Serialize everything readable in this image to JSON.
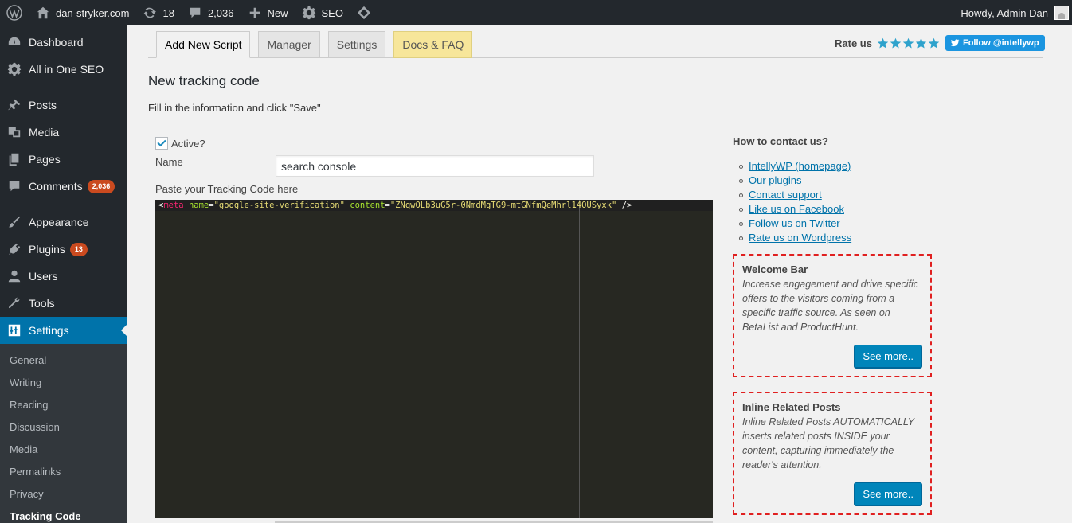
{
  "adminbar": {
    "site_name": "dan-stryker.com",
    "updates_count": "18",
    "comments_count": "2,036",
    "new_label": "New",
    "seo_label": "SEO",
    "howdy": "Howdy, Admin Dan"
  },
  "sidebar": {
    "items": [
      {
        "label": "Dashboard",
        "icon": "dashboard-icon"
      },
      {
        "label": "All in One SEO",
        "icon": "gear-icon"
      },
      {
        "label": "Posts",
        "icon": "pin-icon"
      },
      {
        "label": "Media",
        "icon": "media-icon"
      },
      {
        "label": "Pages",
        "icon": "pages-icon"
      },
      {
        "label": "Comments",
        "icon": "comment-icon",
        "badge": "2,036"
      },
      {
        "label": "Appearance",
        "icon": "brush-icon"
      },
      {
        "label": "Plugins",
        "icon": "plugin-icon",
        "badge": "13"
      },
      {
        "label": "Users",
        "icon": "user-icon"
      },
      {
        "label": "Tools",
        "icon": "wrench-icon"
      },
      {
        "label": "Settings",
        "icon": "settings-icon"
      }
    ],
    "submenu": [
      "General",
      "Writing",
      "Reading",
      "Discussion",
      "Media",
      "Permalinks",
      "Privacy",
      "Tracking Code"
    ]
  },
  "tabs": [
    "Add New Script",
    "Manager",
    "Settings",
    "Docs & FAQ"
  ],
  "rate": {
    "label": "Rate us",
    "twitter_label": "Follow @intellywp"
  },
  "page": {
    "title": "New tracking code",
    "description": "Fill in the information and click \"Save\"",
    "active_label": "Active?",
    "name_label": "Name",
    "name_value": "search console",
    "code_label": "Paste your Tracking Code here"
  },
  "code": {
    "tag": "meta",
    "attr1": "name",
    "val1": "\"google-site-verification\"",
    "attr2": "content",
    "val2": "\"ZNqwOLb3uG5r-0NmdMgTG9-mtGNfmQeMhrl14OUSyxk\""
  },
  "contact": {
    "title": "How to contact us?",
    "links": [
      "IntellyWP (homepage)",
      "Our plugins",
      "Contact support",
      "Like us on Facebook",
      "Follow us on Twitter",
      "Rate us on Wordpress"
    ]
  },
  "promos": [
    {
      "title": "Welcome Bar",
      "text": "Increase engagement and drive specific offers to the visitors coming from a specific traffic source. As seen on BetaList and ProductHunt.",
      "button": "See more.."
    },
    {
      "title": "Inline Related Posts",
      "text": "Inline Related Posts AUTOMATICALLY inserts related posts INSIDE your content, capturing immediately the reader's attention.",
      "button": "See more.."
    }
  ],
  "colors": {
    "admin_dark": "#23282d",
    "accent": "#0073aa",
    "badge": "#ca4a1f",
    "promo_border": "#e02020"
  }
}
